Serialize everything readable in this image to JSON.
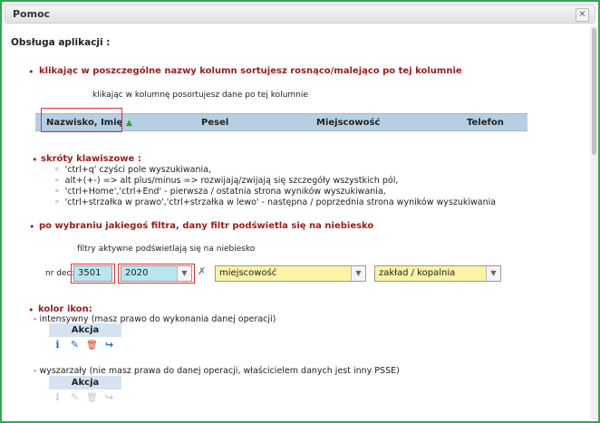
{
  "window": {
    "title": "Pomoc",
    "close_glyph": "×"
  },
  "main_heading": "Obsługa aplikacji :",
  "sort_section": {
    "heading": "klikając w poszczególne nazwy kolumn sortujesz rosnąco/malejąco po tej kolumnie",
    "callout": "klikając w kolumnę posortujesz dane po tej kolumnie",
    "columns": [
      "Nazwisko, Imię",
      "Pesel",
      "Miejscowość",
      "Telefon"
    ],
    "sort_glyph": "▲"
  },
  "shortcuts_section": {
    "heading": "skróty klawiszowe :",
    "items": [
      "'ctrl+q' czyści pole wyszukiwania,",
      "alt+(+-) => alt plus/minus => rozwijają/zwijają się szczegóły wszystkich pól,",
      "'ctrl+Home','ctrl+End' - pierwsza / ostatnia strona wyników wyszukiwania,",
      "'ctrl+strzałka w prawo','ctrl+strzałka w lewo' - następna / poprzednia strona wyników wyszukiwania"
    ]
  },
  "filter_section": {
    "heading": "po wybraniu jakiegoś filtra, dany filtr podświetla się na niebiesko",
    "callout": "filtry aktywne podświetlają się na niebiesko",
    "label": "nr dec:",
    "field1_value": "3501",
    "field2_value": "2020",
    "clear_glyph": "✗",
    "select3_value": "miejscowość",
    "select4_value": "zakład / kopalnia",
    "arrow_glyph": "▼"
  },
  "icons_section": {
    "heading": "kolor ikon:",
    "intense_label": "- intensywny (masz prawo do wykonania danej operacji)",
    "faded_label": "- wyszarzały (nie masz prawa do danej operacji, właścicielem danych jest inny PSSE)",
    "akcja_label": "Akcja",
    "icon_glyphs": {
      "info": "i",
      "edit": "✎",
      "delete": "🗑",
      "share": "↪"
    },
    "colors": {
      "info": "#1a6ac4",
      "edit": "#1a6ac4",
      "delete": "#d23a2a",
      "share": "#1a6ac4",
      "faded": "#c8c8c8"
    }
  },
  "colors": {
    "accent_red": "#9b1c1c",
    "frame_green": "#2fa84f",
    "active_filter": "#b8e6f0",
    "yellow_filter": "#fbf3a6",
    "header_blue": "#b6cfe3"
  }
}
